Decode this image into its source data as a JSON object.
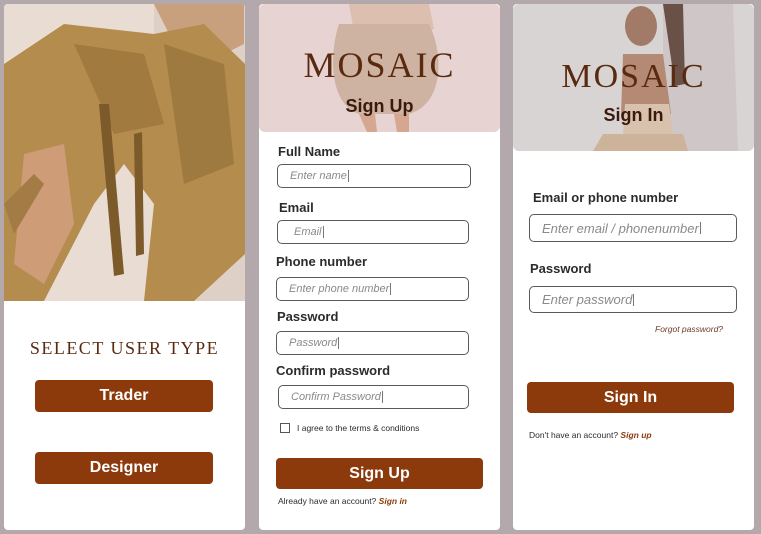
{
  "user_type_screen": {
    "title": "SELECT USER TYPE",
    "trader_label": "Trader",
    "designer_label": "Designer"
  },
  "signup_screen": {
    "brand": "MOSAIC",
    "title": "Sign Up",
    "fields": {
      "full_name": {
        "label": "Full Name",
        "placeholder": "Enter name"
      },
      "email": {
        "label": "Email",
        "placeholder": "Email"
      },
      "phone": {
        "label": "Phone number",
        "placeholder": "Enter phone number"
      },
      "password": {
        "label": "Password",
        "placeholder": "Password"
      },
      "confirm_password": {
        "label": "Confirm password",
        "placeholder": "Confirm Password"
      }
    },
    "terms_label": "I agree to the terms & conditions",
    "submit_label": "Sign Up",
    "footer_text": "Already have an account?",
    "footer_link": "Sign in"
  },
  "signin_screen": {
    "brand": "MOSAIC",
    "title": "Sign In",
    "fields": {
      "email_phone": {
        "label": "Email or phone number",
        "placeholder": "Enter email / phonenumber"
      },
      "password": {
        "label": "Password",
        "placeholder": "Enter password"
      }
    },
    "forgot_label": "Forgot password?",
    "submit_label": "Sign In",
    "footer_text": "Don't have an account?",
    "footer_link": "Sign up"
  },
  "colors": {
    "accent": "#8c3a0c",
    "brand_text": "#5a2a10",
    "background": "#b3a9ad"
  }
}
